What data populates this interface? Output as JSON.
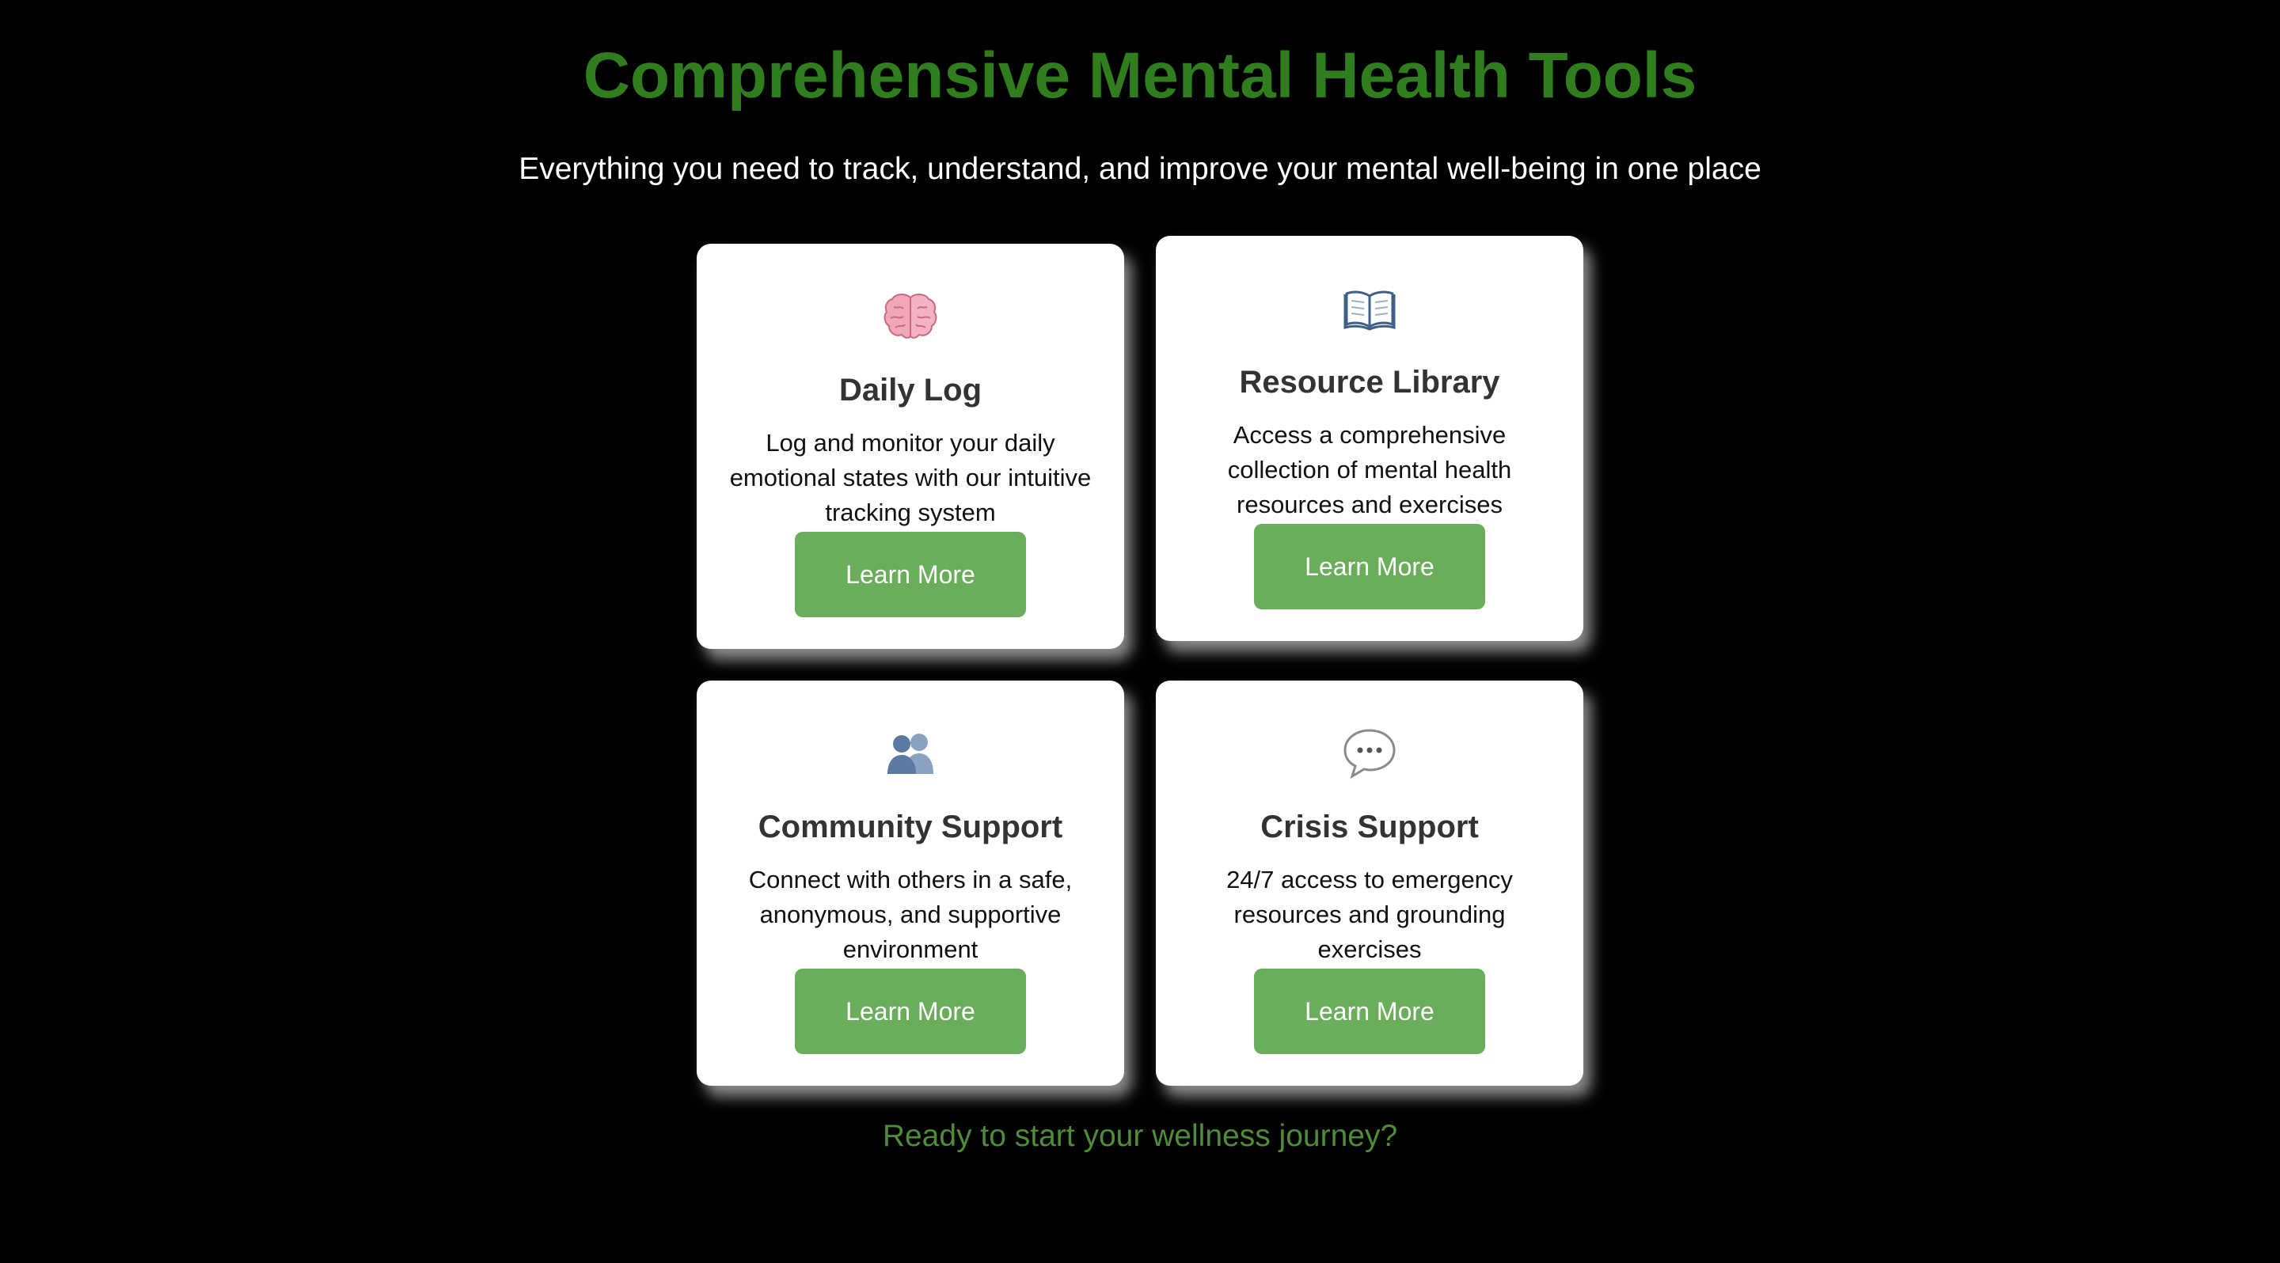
{
  "header": {
    "title": "Comprehensive Mental Health Tools",
    "subtitle": "Everything you need to track, understand, and improve your mental well-being in one place"
  },
  "cards": [
    {
      "icon": "brain-icon",
      "title": "Daily Log",
      "description": "Log and monitor your daily emotional states with our intuitive tracking system",
      "button_label": "Learn More"
    },
    {
      "icon": "book-icon",
      "title": "Resource Library",
      "description": "Access a comprehensive collection of mental health resources and exercises",
      "button_label": "Learn More"
    },
    {
      "icon": "people-icon",
      "title": "Community Support",
      "description": "Connect with others in a safe, anonymous, and supportive environment",
      "button_label": "Learn More"
    },
    {
      "icon": "speech-bubble-icon",
      "title": "Crisis Support",
      "description": "24/7 access to emergency resources and grounding exercises",
      "button_label": "Learn More"
    }
  ],
  "footer": {
    "text": "Ready to start your wellness journey?"
  },
  "colors": {
    "background": "#000000",
    "accent_green": "#2f7d1c",
    "button_green": "#6aad5b",
    "footer_green": "#4f8c3a",
    "card_background": "#ffffff"
  }
}
